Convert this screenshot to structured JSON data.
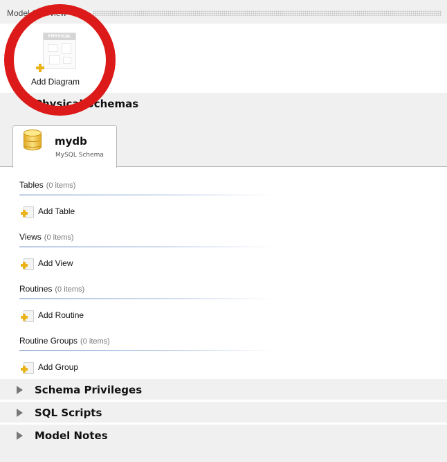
{
  "panel": {
    "title": "Model Overview"
  },
  "diagram": {
    "add_label": "Add Diagram",
    "thumb_caption": "PHYSICAL"
  },
  "physical_schemas": {
    "header": "Physical Schemas",
    "tab": {
      "name": "mydb",
      "subtitle": "MySQL Schema"
    },
    "groups": [
      {
        "title": "Tables",
        "count": "(0 items)",
        "add_label": "Add Table"
      },
      {
        "title": "Views",
        "count": "(0 items)",
        "add_label": "Add View"
      },
      {
        "title": "Routines",
        "count": "(0 items)",
        "add_label": "Add Routine"
      },
      {
        "title": "Routine Groups",
        "count": "(0 items)",
        "add_label": "Add Group"
      }
    ]
  },
  "sections": [
    {
      "label": "Schema Privileges"
    },
    {
      "label": "SQL Scripts"
    },
    {
      "label": "Model Notes"
    }
  ],
  "colors": {
    "annotation": "#dd1a1a",
    "divider": "#5577bb",
    "icon_yellow": "#e9b316"
  },
  "icons": {
    "add": "plus-icon",
    "schema": "database-icon",
    "expand": "triangle-right-icon"
  }
}
